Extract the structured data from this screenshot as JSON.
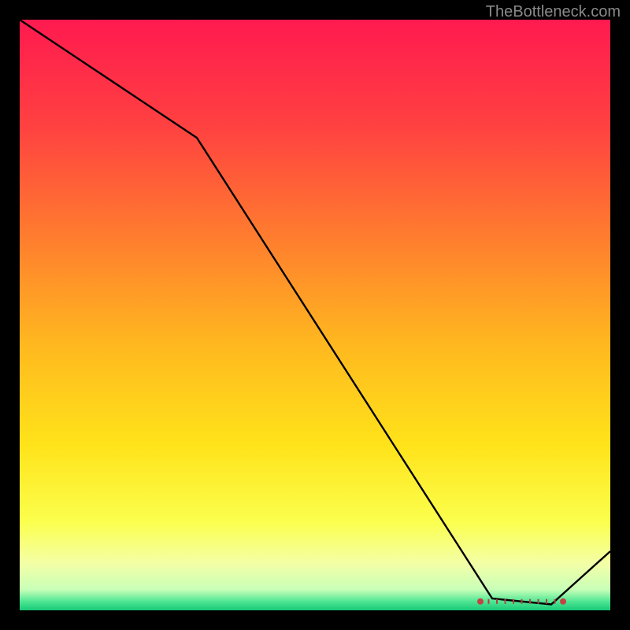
{
  "watermark": "TheBottleneck.com",
  "chart_data": {
    "type": "line",
    "title": "",
    "xlabel": "",
    "ylabel": "",
    "xlim": [
      0,
      100
    ],
    "ylim": [
      0,
      100
    ],
    "grid": false,
    "legend": false,
    "series": [
      {
        "name": "curve",
        "x": [
          0,
          30,
          80,
          90,
          100
        ],
        "y": [
          100,
          80,
          2,
          1,
          10
        ]
      }
    ],
    "flat_region": {
      "x_start": 78,
      "x_end": 92,
      "y": 1.5
    },
    "band_markers": {
      "x_start": 78,
      "x_end": 92,
      "y": 1.5
    },
    "gradient_stops": [
      {
        "offset": 0.0,
        "color": "#ff1a4f"
      },
      {
        "offset": 0.18,
        "color": "#ff4141"
      },
      {
        "offset": 0.36,
        "color": "#ff7a2f"
      },
      {
        "offset": 0.55,
        "color": "#ffb81f"
      },
      {
        "offset": 0.72,
        "color": "#ffe31a"
      },
      {
        "offset": 0.85,
        "color": "#fbff4d"
      },
      {
        "offset": 0.92,
        "color": "#f4ffa6"
      },
      {
        "offset": 0.965,
        "color": "#c8ffb8"
      },
      {
        "offset": 0.985,
        "color": "#4fe693"
      },
      {
        "offset": 1.0,
        "color": "#18c977"
      }
    ]
  }
}
